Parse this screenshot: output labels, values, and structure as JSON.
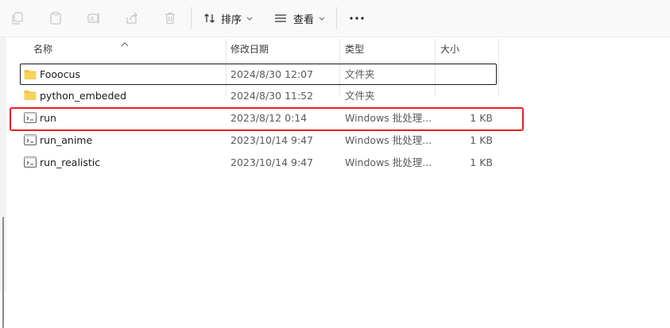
{
  "toolbar": {
    "sort_label": "排序",
    "view_label": "查看"
  },
  "columns": {
    "name": "名称",
    "modified": "修改日期",
    "type": "类型",
    "size": "大小"
  },
  "files": [
    {
      "name": "Fooocus",
      "modified": "2024/8/30 12:07",
      "type": "文件夹",
      "size": "",
      "icon": "folder-icon"
    },
    {
      "name": "python_embeded",
      "modified": "2024/8/30 11:52",
      "type": "文件夹",
      "size": "",
      "icon": "folder-icon"
    },
    {
      "name": "run",
      "modified": "2023/8/12 0:14",
      "type": "Windows 批处理...",
      "size": "1 KB",
      "icon": "batch-file-icon"
    },
    {
      "name": "run_anime",
      "modified": "2023/10/14 9:47",
      "type": "Windows 批处理...",
      "size": "1 KB",
      "icon": "batch-file-icon"
    },
    {
      "name": "run_realistic",
      "modified": "2023/10/14 9:47",
      "type": "Windows 批处理...",
      "size": "1 KB",
      "icon": "batch-file-icon"
    }
  ],
  "colors": {
    "highlight": "#e81e25",
    "folder": "#f3c13a"
  }
}
